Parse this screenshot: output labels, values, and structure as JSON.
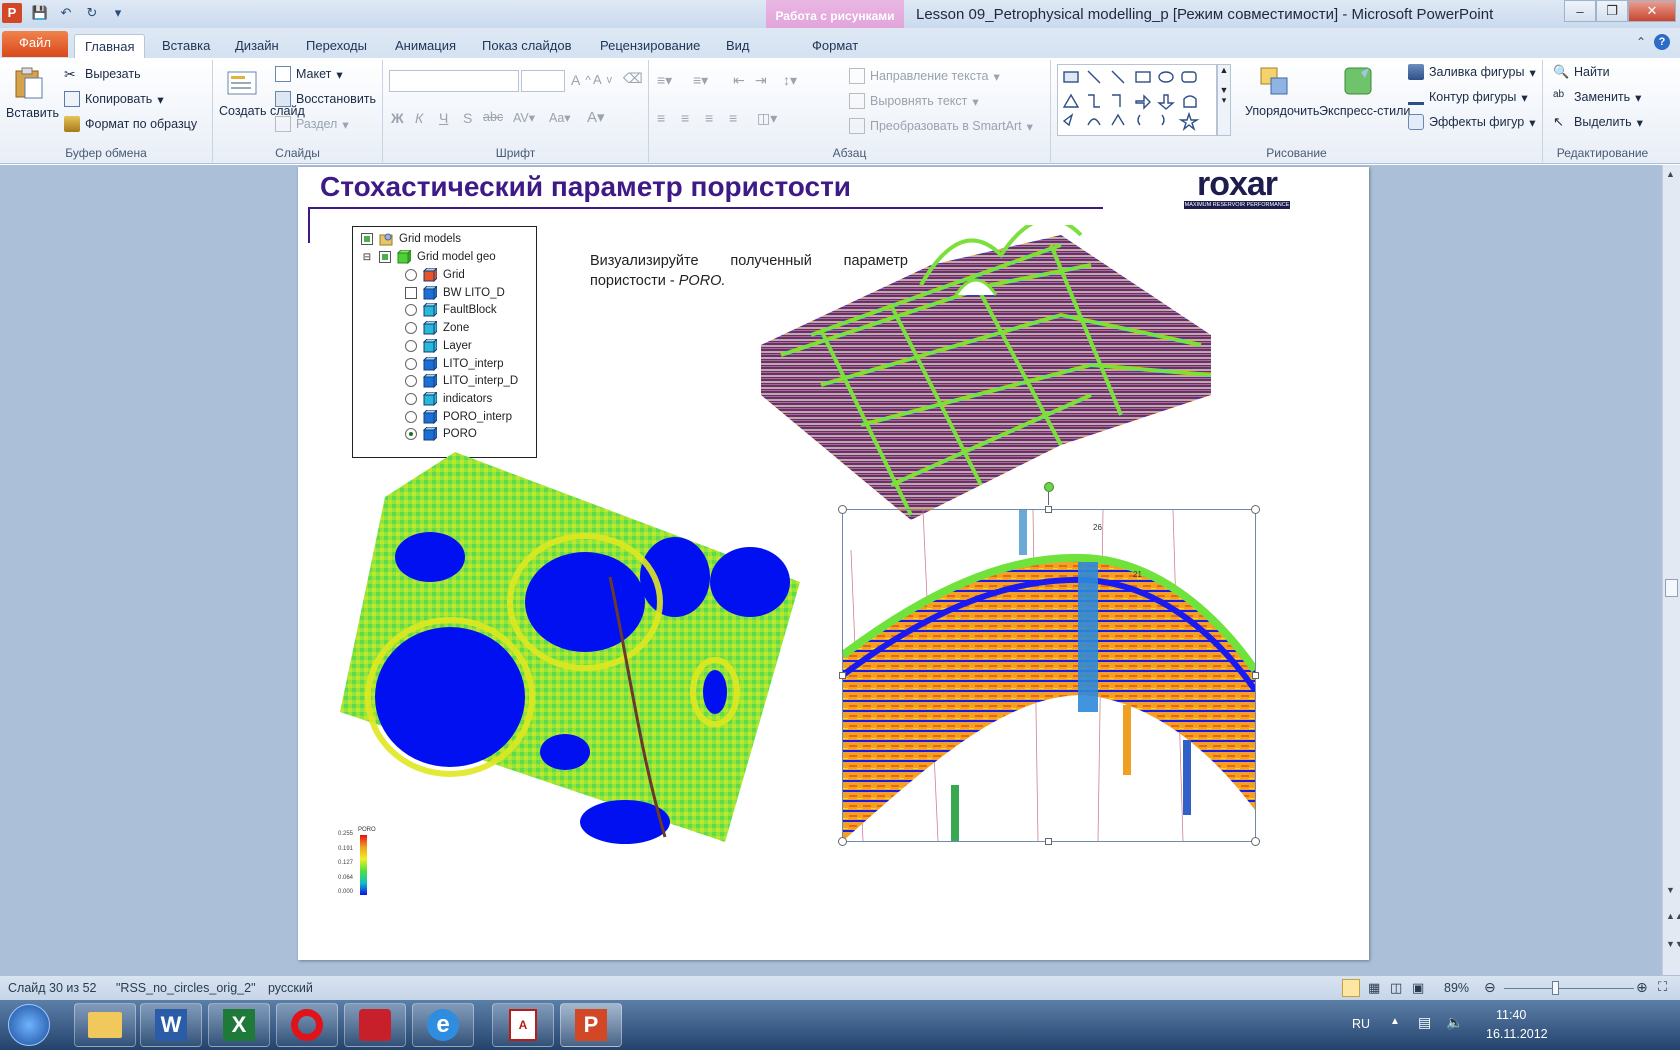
{
  "window": {
    "title": "Lesson 09_Petrophysical modelling_p [Режим совместимости]  -  Microsoft PowerPoint",
    "context_tab": "Работа с рисунками",
    "app_letter": "P"
  },
  "tabs": [
    "Файл",
    "Главная",
    "Вставка",
    "Дизайн",
    "Переходы",
    "Анимация",
    "Показ слайдов",
    "Рецензирование",
    "Вид",
    "Формат"
  ],
  "ribbon": {
    "clipboard": {
      "label": "Буфер обмена",
      "paste": "Вставить",
      "cut": "Вырезать",
      "copy": "Копировать",
      "format_painter": "Формат по образцу"
    },
    "slides": {
      "label": "Слайды",
      "new_slide": "Создать слайд",
      "layout": "Макет",
      "reset": "Восстановить",
      "section": "Раздел"
    },
    "font": {
      "label": "Шрифт"
    },
    "paragraph": {
      "label": "Абзац",
      "text_direction": "Направление текста",
      "align_text": "Выровнять текст",
      "smartart": "Преобразовать в SmartArt"
    },
    "drawing": {
      "label": "Рисование",
      "arrange": "Упорядочить",
      "quick_styles": "Экспресс-стили",
      "fill": "Заливка фигуры",
      "outline": "Контур фигуры",
      "effects": "Эффекты фигур"
    },
    "editing": {
      "label": "Редактирование",
      "find": "Найти",
      "replace": "Заменить",
      "select": "Выделить"
    }
  },
  "slide": {
    "title": "Стохастический параметр пористости",
    "logo_text": "roxar",
    "logo_tagline": "MAXIMUM RESERVOIR PERFORMANCE",
    "description_main": "Визуализируйте полученный параметр пористости - ",
    "description_italic": "PORO.",
    "tree": {
      "root": "Grid models",
      "model": "Grid model geo",
      "items": [
        "Grid",
        "BW LITO_D",
        "FaultBlock",
        "Zone",
        "Layer",
        "LITO_interp",
        "LITO_interp_D",
        "indicators",
        "PORO_interp",
        "PORO"
      ]
    },
    "legend": {
      "title": "PORO",
      "ticks": [
        "0.255",
        "0.191",
        "0.127",
        "0.064",
        "0.000"
      ]
    },
    "well_labels": [
      "26",
      "21"
    ]
  },
  "status": {
    "slide": "Слайд 30 из 52",
    "theme": "\"RSS_no_circles_orig_2\"",
    "language": "русский",
    "zoom": "89%"
  },
  "tray": {
    "lang": "RU",
    "time": "11:40",
    "date": "16.11.2012"
  }
}
